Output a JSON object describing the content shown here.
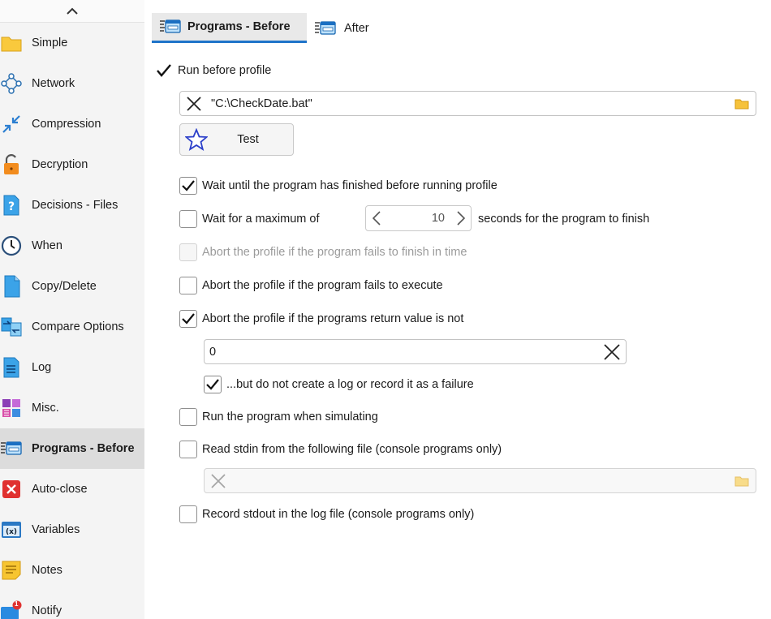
{
  "sidebar": {
    "items": [
      {
        "label": "Simple",
        "icon": "folder-icon"
      },
      {
        "label": "Network",
        "icon": "network-icon"
      },
      {
        "label": "Compression",
        "icon": "compress-arrows-icon"
      },
      {
        "label": "Decryption",
        "icon": "unlock-icon"
      },
      {
        "label": "Decisions - Files",
        "icon": "question-document-icon"
      },
      {
        "label": "When",
        "icon": "clock-icon"
      },
      {
        "label": "Copy/Delete",
        "icon": "copy-document-icon"
      },
      {
        "label": "Compare Options",
        "icon": "compare-arrows-icon"
      },
      {
        "label": "Log",
        "icon": "log-document-icon"
      },
      {
        "label": "Misc.",
        "icon": "misc-squares-icon"
      },
      {
        "label": "Programs - Before",
        "icon": "program-window-icon",
        "active": true
      },
      {
        "label": "Auto-close",
        "icon": "red-x-icon"
      },
      {
        "label": "Variables",
        "icon": "variables-window-icon"
      },
      {
        "label": "Notes",
        "icon": "sticky-note-icon"
      },
      {
        "label": "Notify",
        "icon": "notify-badge-icon",
        "badge": "1"
      }
    ]
  },
  "tabs": [
    {
      "label": "Programs - Before",
      "active": true
    },
    {
      "label": "After",
      "active": false
    }
  ],
  "run_before": {
    "label": "Run before profile",
    "checked": true
  },
  "program_path": {
    "value": "\"C:\\CheckDate.bat\""
  },
  "test_button": {
    "label": "Test"
  },
  "options": {
    "wait_finish": {
      "label": "Wait until the program has finished before running profile",
      "checked": true
    },
    "wait_max": {
      "label": "Wait for a maximum of",
      "checked": false,
      "suffix": "seconds for the program to finish",
      "value": "10"
    },
    "abort_timeout": {
      "label": "Abort the profile if the program fails to finish in time",
      "checked": false,
      "disabled": true
    },
    "abort_execute": {
      "label": "Abort the profile if the program fails to execute",
      "checked": false
    },
    "abort_return": {
      "label": "Abort the profile if the programs return value is not",
      "checked": true
    },
    "return_value": "0",
    "no_log_failure": {
      "label": "...but do not create a log or record it as a failure",
      "checked": true
    },
    "run_simulating": {
      "label": "Run the program when simulating",
      "checked": false
    },
    "read_stdin": {
      "label": "Read stdin from the following file (console programs only)",
      "checked": false
    },
    "stdin_file": "",
    "record_stdout": {
      "label": "Record stdout in the log file (console programs only)",
      "checked": false
    }
  },
  "colors": {
    "accent": "#1f74c9",
    "sidebar_bg": "#f4f4f4",
    "active_bg": "#dcdcdc"
  }
}
